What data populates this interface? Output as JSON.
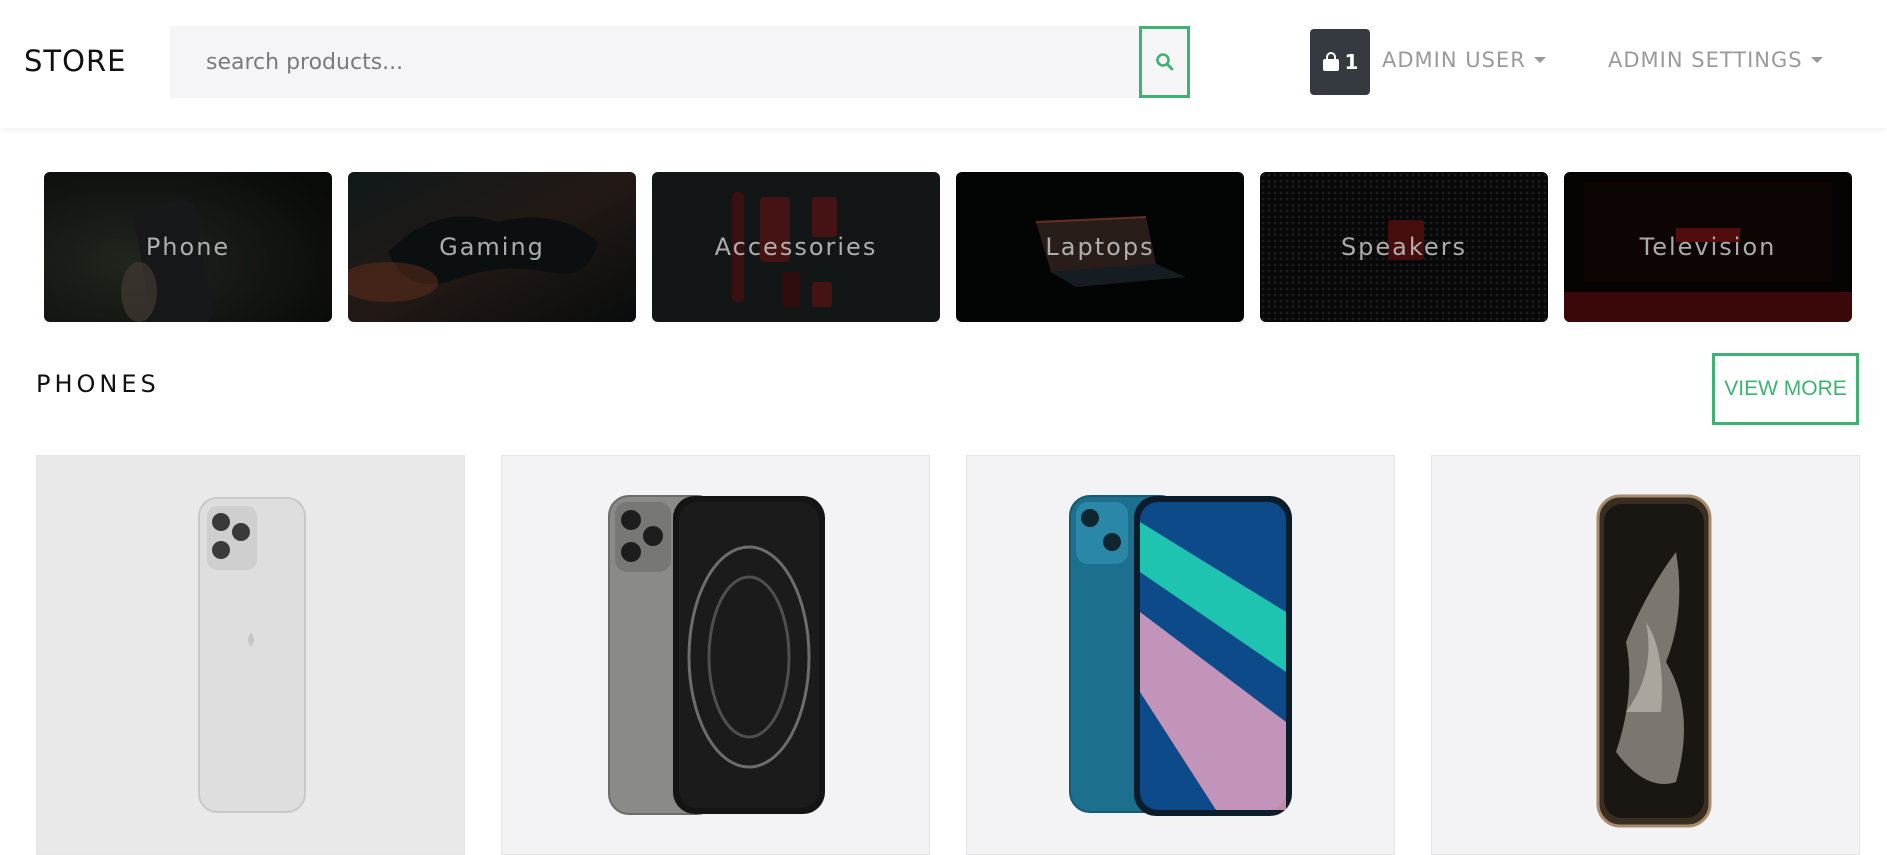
{
  "header": {
    "brand": "STORE",
    "search_placeholder": "search products...",
    "cart_count": "1",
    "user_menu": "ADMIN USER",
    "settings_menu": "ADMIN SETTINGS"
  },
  "categories": [
    {
      "label": "Phone"
    },
    {
      "label": "Gaming"
    },
    {
      "label": "Accessories"
    },
    {
      "label": "Laptops"
    },
    {
      "label": "Speakers"
    },
    {
      "label": "Television"
    }
  ],
  "section": {
    "title": "PHONES",
    "view_more": "VIEW MORE"
  },
  "products": [
    {
      "image": "silver iphone back"
    },
    {
      "image": "graphite iphone pro"
    },
    {
      "image": "blue iphone 13"
    },
    {
      "image": "gold iphone pro"
    }
  ],
  "colors": {
    "accent": "#3cb371",
    "cart_bg": "#343a40",
    "muted": "#9a9a9a"
  },
  "icons": {
    "search": "search-icon",
    "cart": "shopping-bag-icon",
    "caret": "chevron-down-icon"
  }
}
